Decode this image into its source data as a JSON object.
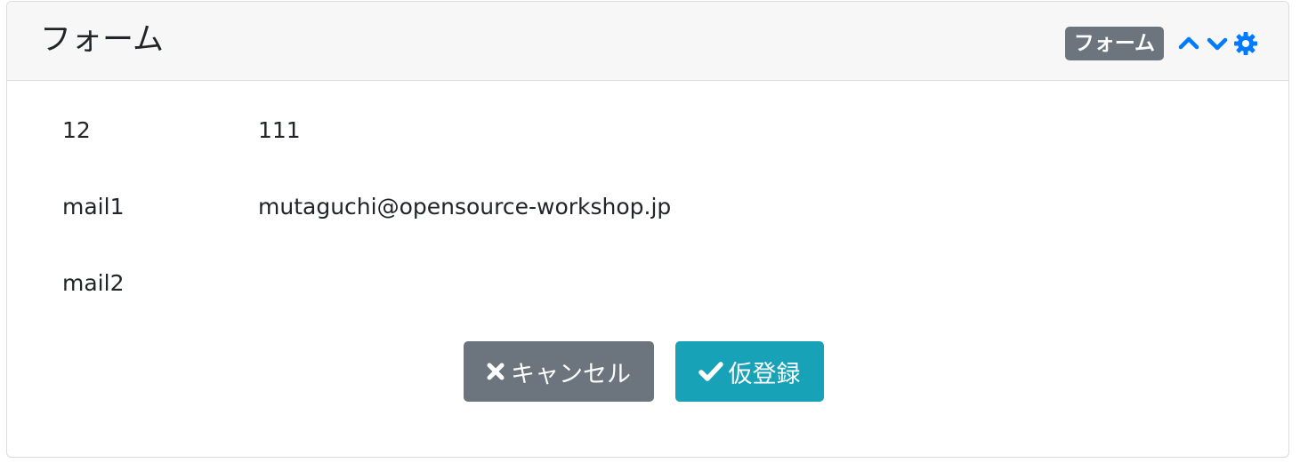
{
  "header": {
    "title": "フォーム",
    "badge": "フォーム",
    "icons": [
      "chevron-up-icon",
      "chevron-down-icon",
      "gear-icon"
    ]
  },
  "fields": [
    {
      "label": "12",
      "value": "111"
    },
    {
      "label": "mail1",
      "value": "mutaguchi@opensource-workshop.jp"
    },
    {
      "label": "mail2",
      "value": ""
    }
  ],
  "buttons": {
    "cancel_label": "キャンセル",
    "submit_label": "仮登録",
    "cancel_icon": "times-icon",
    "submit_icon": "check-icon"
  },
  "colors": {
    "accent": "#007bff",
    "secondary": "#6c757d",
    "info": "#17a2b8",
    "header_bg": "#f7f7f7"
  }
}
